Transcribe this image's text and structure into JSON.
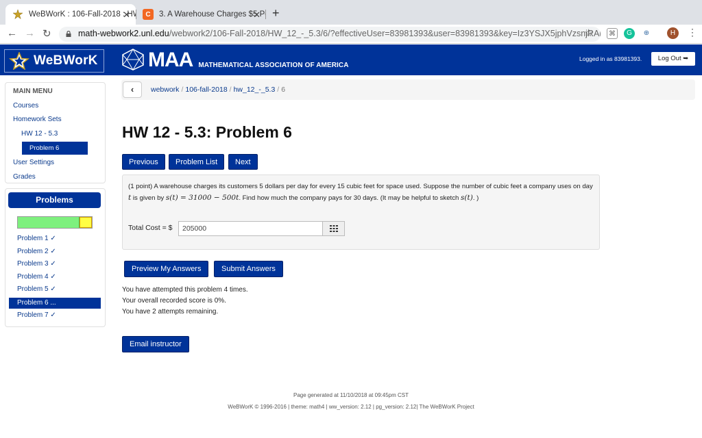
{
  "browser": {
    "tabs": [
      {
        "title": "WeBWorK : 106-Fall-2018 : HW",
        "active": true
      },
      {
        "title": "3. A Warehouse Charges $5 Pe",
        "active": false
      }
    ],
    "url_host": "math-webwork2.unl.edu",
    "url_path": "/webwork2/106-Fall-2018/HW_12_-_5.3/6/?effectiveUser=83981393&user=83981393&key=Iz3YSJX5jphVzsnjRAbl...",
    "profile_initial": "H"
  },
  "header": {
    "logo_text": "WeBWorK",
    "maa_text": "MAA",
    "maa_subtitle": "MATHEMATICAL ASSOCIATION OF AMERICA",
    "logged_in": "Logged in as 83981393.",
    "logout_label": "Log Out"
  },
  "sidebar": {
    "main_menu_title": "MAIN MENU",
    "items": [
      "Courses",
      "Homework Sets",
      "HW 12 - 5.3",
      "Problem 6",
      "User Settings",
      "Grades"
    ],
    "problems_title": "Problems",
    "progress": {
      "complete_fraction": 0.83,
      "partial_fraction": 0.17
    },
    "problem_links": [
      "Problem 1 ✓",
      "Problem 2 ✓",
      "Problem 3 ✓",
      "Problem 4 ✓",
      "Problem 5 ✓",
      "Problem 6 ...",
      "Problem 7 ✓"
    ]
  },
  "breadcrumb": {
    "items": [
      "webwork",
      "106-fall-2018",
      "hw_12_-_5.3",
      "6"
    ]
  },
  "main": {
    "title": "HW 12 - 5.3: Problem 6",
    "nav_buttons": [
      "Previous",
      "Problem List",
      "Next"
    ],
    "problem": {
      "text_1": "(1 point) A warehouse charges its customers 5 dollars per day for every 15 cubic feet for space used. Suppose the number of cubic feet a company uses on day",
      "var_t": "t",
      "text_2": "is given by",
      "formula": "s(t) = 31000 − 500t",
      "text_3": ". Find how much the company pays for 30 days. (It may be helpful to sketch",
      "formula_2": "s(t)",
      "text_4": ". )",
      "answer_label": "Total Cost = $",
      "answer_value": "205000"
    },
    "action_buttons": [
      "Preview My Answers",
      "Submit Answers"
    ],
    "status": [
      "You have attempted this problem 4 times.",
      "Your overall recorded score is 0%.",
      "You have 2 attempts remaining."
    ],
    "email_label": "Email instructor"
  },
  "footer": {
    "generated": "Page generated at 11/10/2018 at 09:45pm CST",
    "credits": "WeBWorK © 1996-2016 | theme: math4 | ww_version: 2.12 | pg_version: 2.12| The WeBWorK Project"
  }
}
